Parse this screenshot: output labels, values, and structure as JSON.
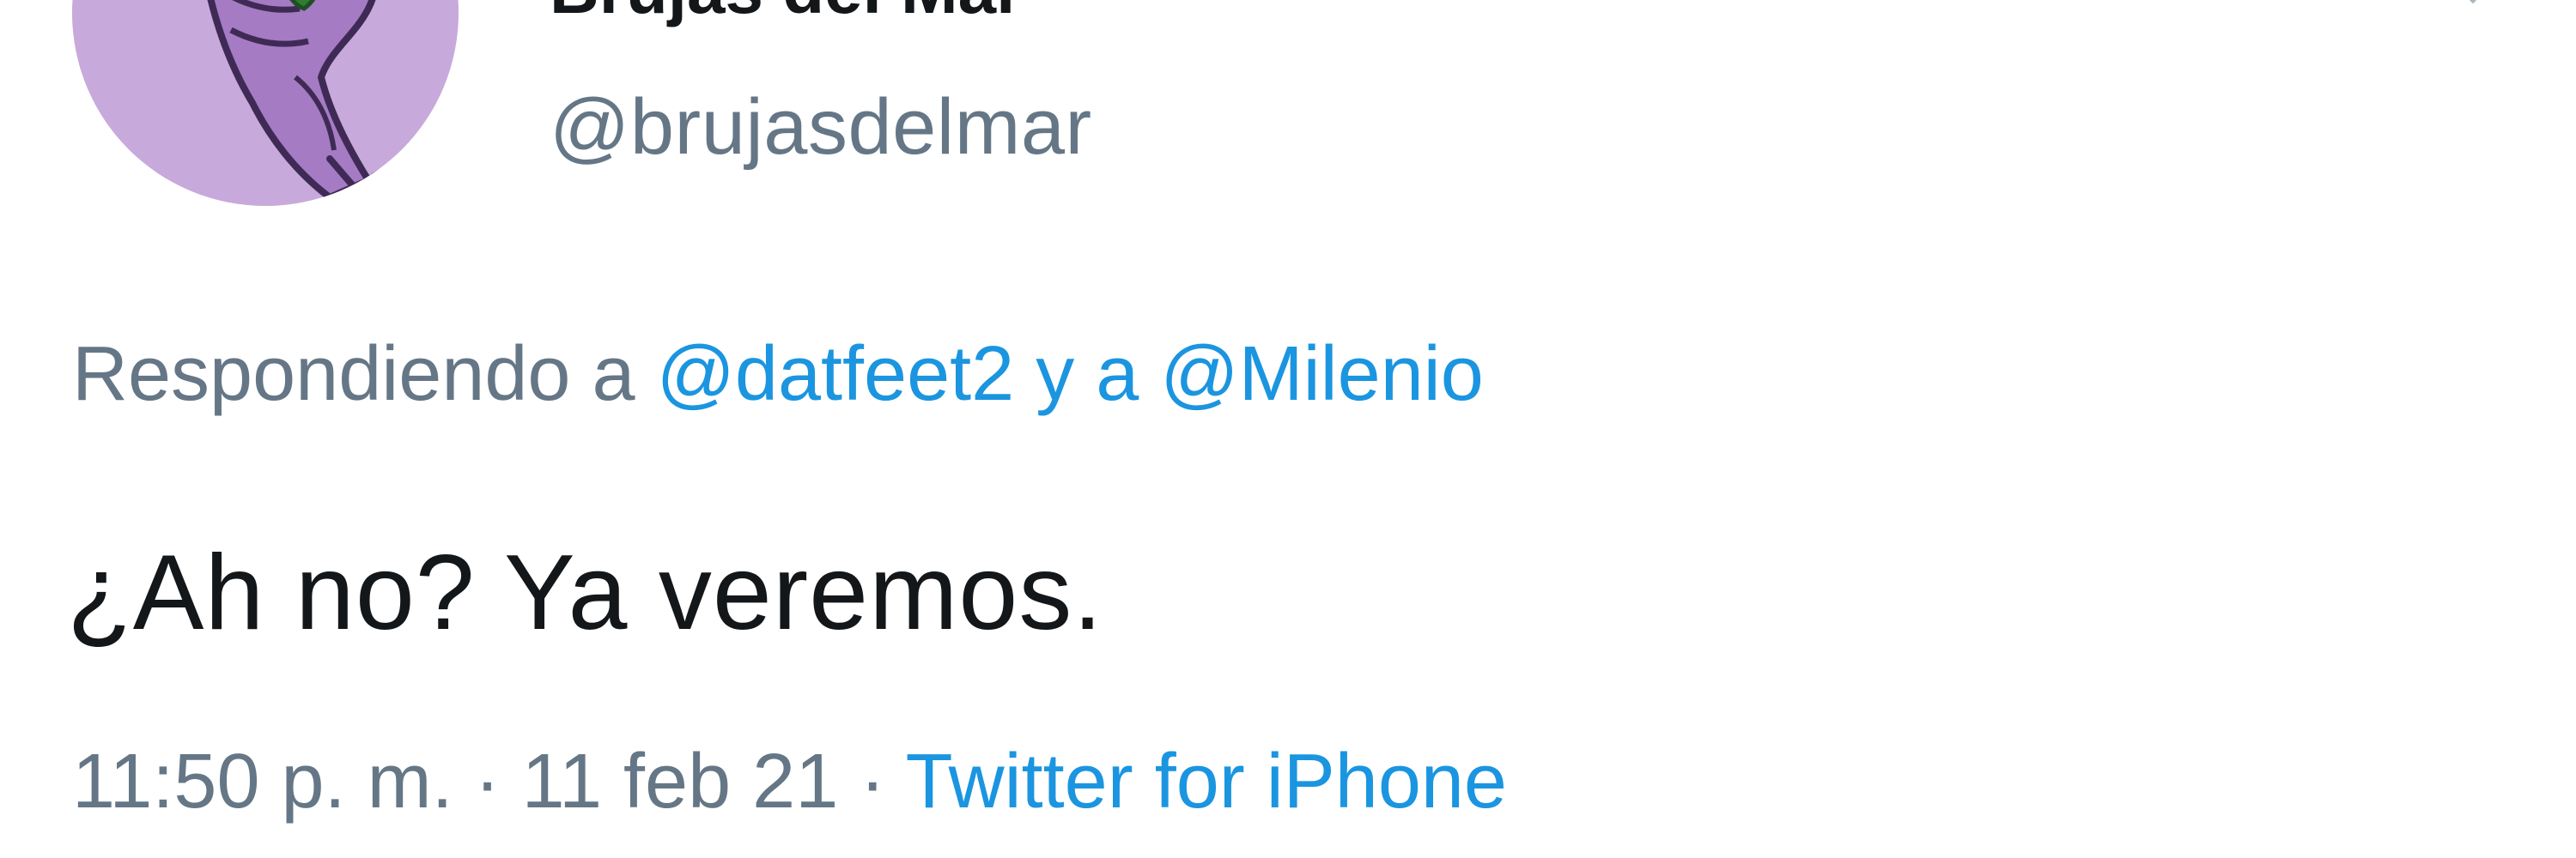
{
  "tweet": {
    "display_name": "Brujas del Mar",
    "handle": "@brujasdelmar",
    "reply": {
      "prefix": "Respondiendo a",
      "mention_1": "@datfeet2",
      "joiner": "y a",
      "mention_2": "@Milenio"
    },
    "text": "¿Ah no? Ya veremos.",
    "meta": {
      "time": "11:50 p. m.",
      "separator": "·",
      "date": "11 feb 21",
      "source": "Twitter for iPhone"
    }
  },
  "icons": {
    "avatar": "raised-fist-avatar",
    "caret": "chevron-down-icon"
  },
  "colors": {
    "text_primary": "#14171a",
    "text_secondary": "#657786",
    "link": "#1b95e0",
    "avatar_bg": "#c8a9dc"
  }
}
